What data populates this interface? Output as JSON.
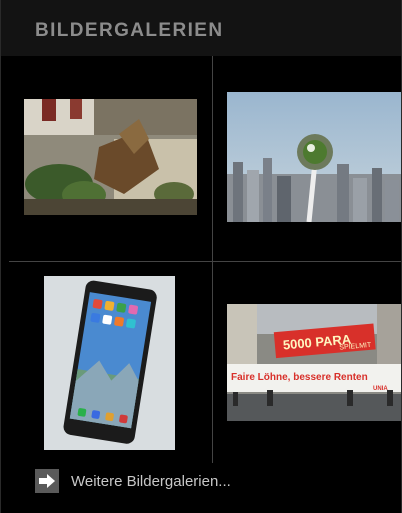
{
  "header": {
    "title": "BILDERGALERIEN"
  },
  "galleries": [
    {
      "id": "garden-tree-stump",
      "icon": "photo-garden-stump"
    },
    {
      "id": "city-power-plug",
      "icon": "photo-city-plug"
    },
    {
      "id": "smartphone",
      "icon": "photo-smartphone"
    },
    {
      "id": "demonstration-banner",
      "icon": "photo-demonstration",
      "banner_top": "5000 PARA",
      "banner_top_right": "SPIELMIT",
      "banner_main": "Faire Löhne, bessere Renten",
      "banner_logo": "UNIA"
    }
  ],
  "footer": {
    "more_label": "Weitere Bildergalerien...",
    "icon": "arrow-right-icon"
  }
}
